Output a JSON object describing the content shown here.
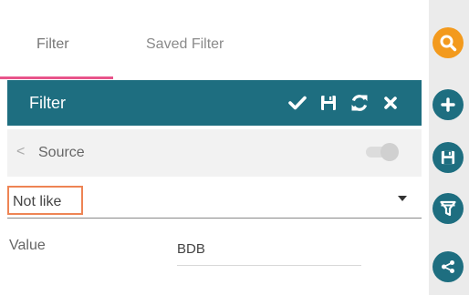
{
  "tabs": {
    "filter_label": "Filter",
    "saved_filter_label": "Saved Filter",
    "active": "Filter"
  },
  "header": {
    "title": "Filter",
    "icons": [
      "check-icon",
      "save-icon",
      "refresh-icon",
      "close-icon"
    ]
  },
  "source": {
    "label": "Source",
    "toggle_state": "off"
  },
  "condition": {
    "selected": "Not like"
  },
  "value_field": {
    "label": "Value",
    "value": "BDB"
  },
  "side_toolbar": {
    "icons": [
      "search-icon",
      "plus-icon",
      "save-icon",
      "filter-icon",
      "share-icon"
    ]
  },
  "colors": {
    "header_bg": "#1e6e80",
    "accent_tab": "#e8548a",
    "highlight_box": "#ee8454",
    "search_button": "#f39a1d"
  }
}
